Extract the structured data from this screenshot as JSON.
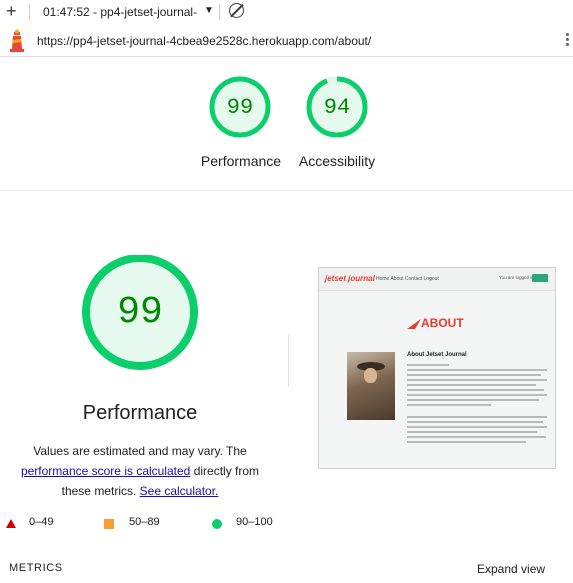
{
  "toolbar": {
    "run_title": "01:47:52 - pp4-jetset-journal-",
    "new_icon": "plus-icon",
    "dropdown_icon": "caret-down-icon",
    "clear_icon": "ban-icon"
  },
  "address": {
    "url": "https://pp4-jetset-journal-4cbea9e2528c.herokuapp.com/about/",
    "icon": "lighthouse-icon"
  },
  "summary_gauges": [
    {
      "score": "99",
      "label": "Performance"
    },
    {
      "score": "94",
      "label": "Accessibility"
    }
  ],
  "main_gauge": {
    "score": "99",
    "score_fraction": 0.99,
    "title": "Performance"
  },
  "description": {
    "pre": "Values are estimated and may vary. The ",
    "link1": "performance score is calculated",
    "mid": " directly from these metrics. ",
    "link2": "See calculator."
  },
  "screenshot": {
    "logo": "jetset journal",
    "nav_links": "Home   About   Contact   Logout",
    "user_text": "You are logged in as",
    "heading": "ABOUT",
    "subheading": "About Jetset Journal"
  },
  "legend": {
    "fail": "0–49",
    "average": "50–89",
    "pass": "90–100"
  },
  "colors": {
    "pass": "#0cce6b",
    "average": "#fa9e31",
    "fail": "#cc0000",
    "score_text": "#008800"
  },
  "footer": {
    "metrics_label": "METRICS",
    "expand_label": "Expand view"
  }
}
